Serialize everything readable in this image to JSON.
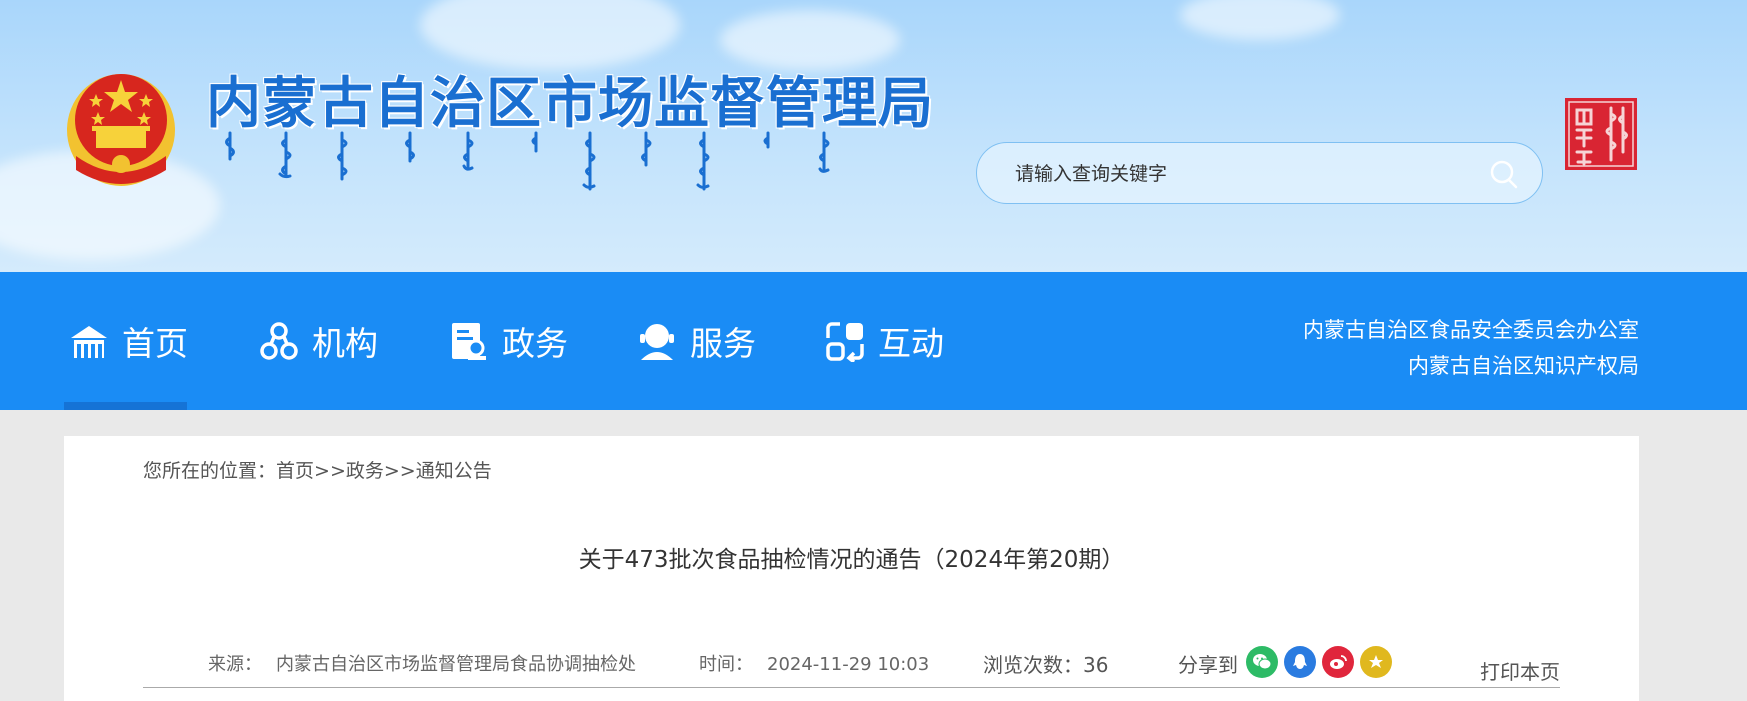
{
  "header": {
    "site_title": "内蒙古自治区市场监督管理局",
    "search_placeholder": "请输入查询关键字"
  },
  "nav": {
    "items": [
      {
        "label": "首页",
        "icon": "home-icon"
      },
      {
        "label": "机构",
        "icon": "organization-icon"
      },
      {
        "label": "政务",
        "icon": "government-affairs-icon"
      },
      {
        "label": "服务",
        "icon": "service-icon"
      },
      {
        "label": "互动",
        "icon": "interaction-icon"
      }
    ],
    "side_links": [
      "内蒙古自治区食品安全委员会办公室",
      "内蒙古自治区知识产权局"
    ]
  },
  "breadcrumb": {
    "prefix": "您所在的位置：",
    "items": [
      "首页",
      "政务",
      "通知公告"
    ],
    "separator": ">>"
  },
  "article": {
    "title": "关于473批次食品抽检情况的通告（2024年第20期）",
    "source_label": "来源：",
    "source": "内蒙古自治区市场监督管理局食品协调抽检处",
    "time_label": "时间：",
    "time": "2024-11-29 10:03",
    "views_label": "浏览次数：",
    "views": "36",
    "share_label": "分享到",
    "share_targets": [
      {
        "name": "wechat",
        "color": "#2dbb66"
      },
      {
        "name": "qq",
        "color": "#2a7be0"
      },
      {
        "name": "weibo",
        "color": "#e0263c"
      },
      {
        "name": "qzone",
        "color": "#e0b81e"
      }
    ],
    "print_label": "打印本页"
  },
  "colors": {
    "nav_bg": "#1a8cf5",
    "title_blue": "#1a6fd1",
    "page_bg": "#e9e9e9"
  }
}
